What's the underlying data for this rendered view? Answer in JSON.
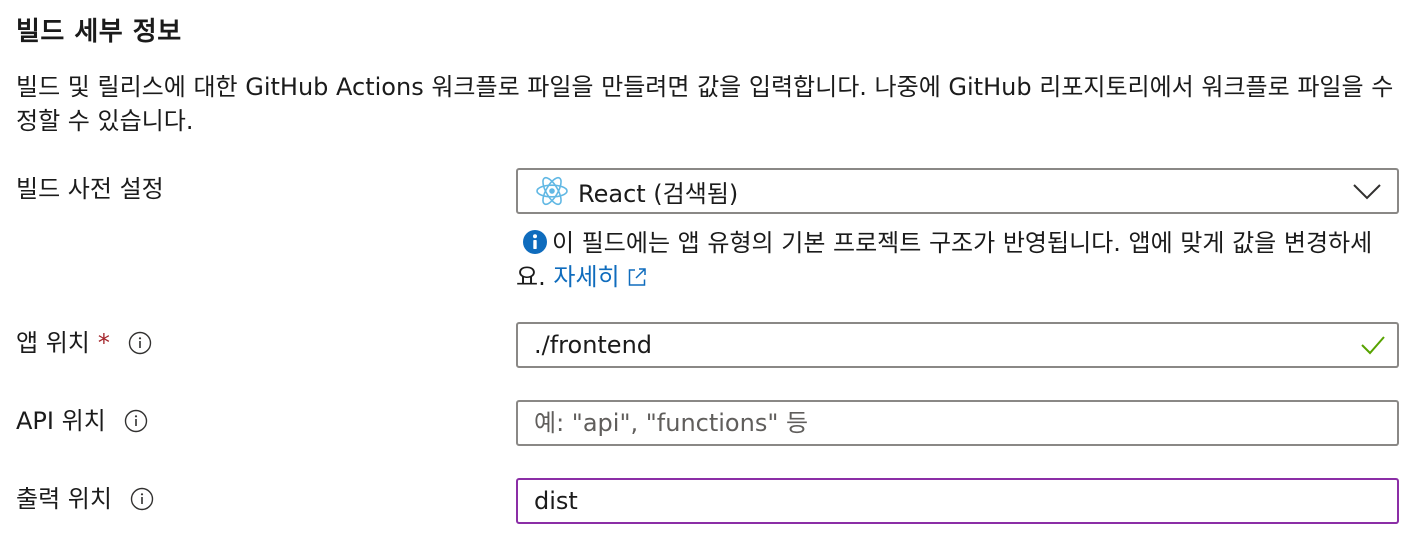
{
  "section": {
    "title": "빌드 세부 정보",
    "description": "빌드 및 릴리스에 대한 GitHub Actions 워크플로 파일을 만들려면 값을 입력합니다. 나중에 GitHub 리포지토리에서 워크플로 파일을 수정할 수 있습니다."
  },
  "build_preset": {
    "label": "빌드 사전 설정",
    "value": "React (검색됨)",
    "icon": "react-icon",
    "hint_text": "이 필드에는 앱 유형의 기본 프로젝트 구조가 반영됩니다. 앱에 맞게 값을 변경하세요.",
    "learn_more": "자세히"
  },
  "app_location": {
    "label": "앱 위치",
    "required_mark": "*",
    "value": "./frontend",
    "valid": true
  },
  "api_location": {
    "label": "API 위치",
    "value": "",
    "placeholder": "예: \"api\", \"functions\" 등"
  },
  "output_location": {
    "label": "출력 위치",
    "value": "dist"
  },
  "colors": {
    "link": "#0f6cbd",
    "required": "#a4262c",
    "focus_border": "#8b2ea6",
    "valid_check": "#57a300",
    "info_fill": "#0f6cbd"
  }
}
